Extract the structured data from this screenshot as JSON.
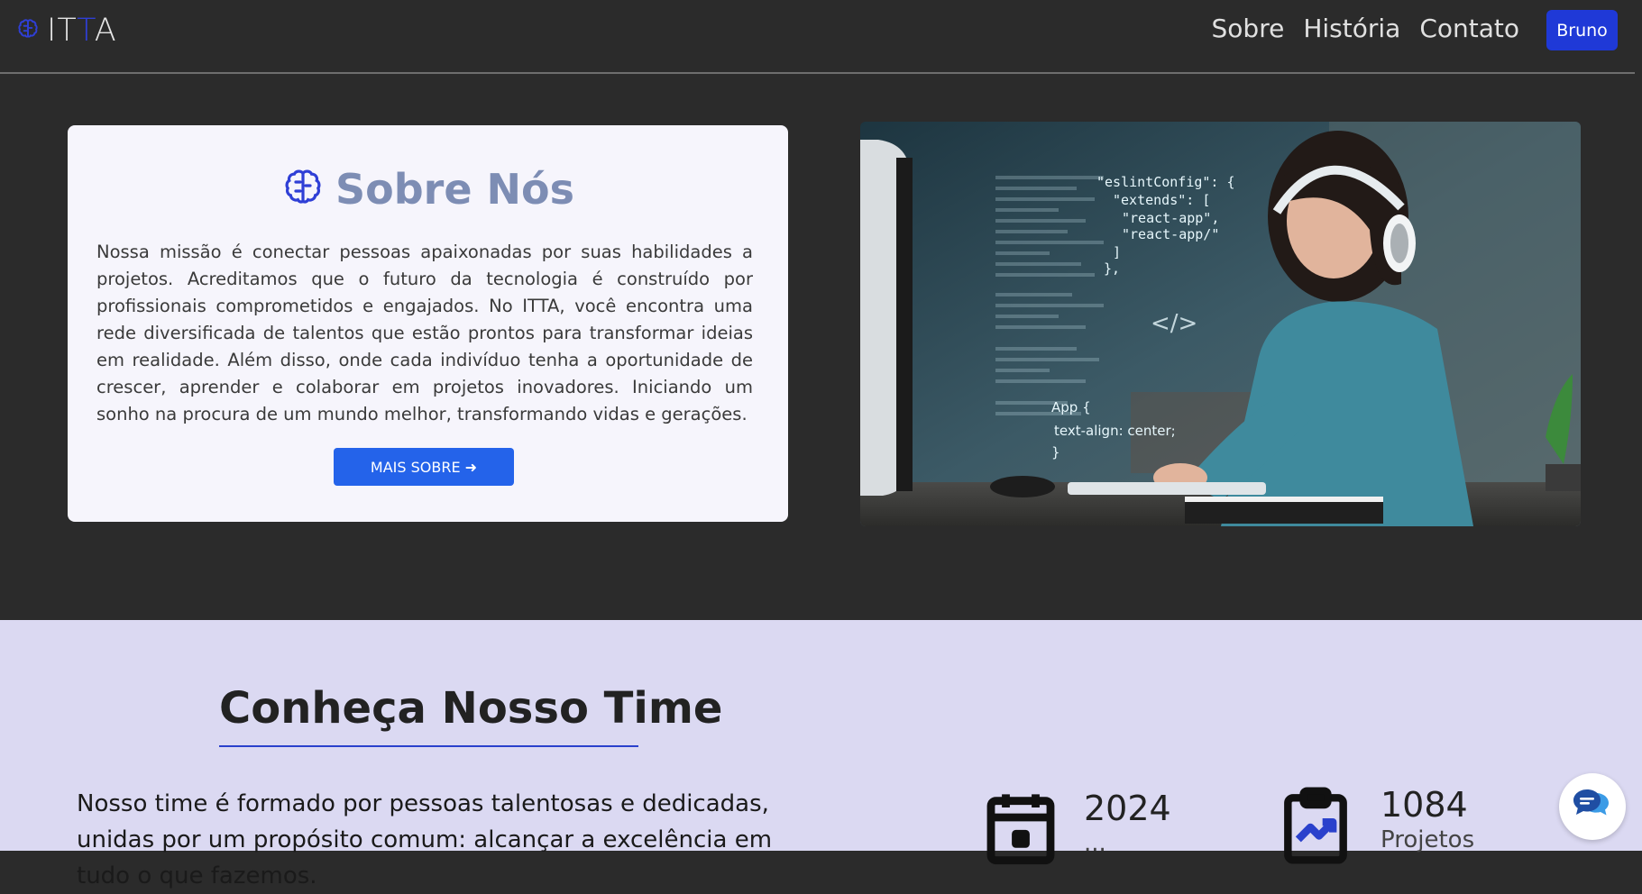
{
  "navbar": {
    "brand_prefix": "IT",
    "brand_accent": "T",
    "brand_suffix": "A",
    "links": [
      "Sobre",
      "História",
      "Contato"
    ],
    "user_button": "Bruno"
  },
  "about": {
    "title": "Sobre Nós",
    "text": "Nossa missão é conectar pessoas apaixonadas por suas habilidades a projetos. Acreditamos que o futuro da tecnologia é construído por profissionais comprometidos e engajados. No ITTA, você encontra uma rede diversificada de talentos que estão prontos para transformar ideias em realidade. Além disso, onde cada indivíduo tenha a oportunidade de crescer, aprender e colaborar em projetos inovadores. Iniciando um sonho na procura de um mundo melhor, transformando vidas e gerações.",
    "button": "MAIS SOBRE ➜"
  },
  "hero": {
    "code_lines": [
      "\"eslintConfig\": {",
      "\"extends\": [",
      "\"react-app\",",
      "\"react-app/\"",
      "]",
      "},"
    ],
    "css_lines": [
      "App {",
      "text-align: center;",
      "}"
    ],
    "tag": "</>"
  },
  "team": {
    "title": "Conheça Nosso Time",
    "text": "Nosso time é formado por pessoas talentosas e dedicadas, unidas por um propósito comum: alcançar a excelência em tudo o que fazemos.",
    "stats": [
      {
        "value": "2024",
        "label": "...",
        "icon": "calendar-icon"
      },
      {
        "value": "1084",
        "label": "Projetos",
        "icon": "clipboard-chart-icon"
      }
    ]
  },
  "colors": {
    "accent": "#1f39d7",
    "button": "#2463ea",
    "team_bg": "#dbd9f2",
    "page_bg": "#2b2b2b"
  }
}
